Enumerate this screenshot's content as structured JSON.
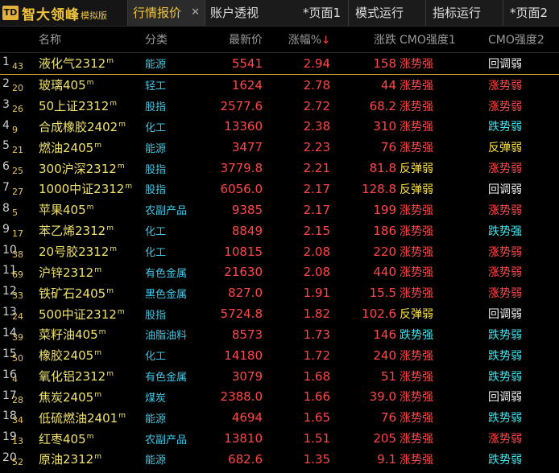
{
  "app": {
    "logo_mark": "TD",
    "title": "智大领峰",
    "subtitle": "模拟版"
  },
  "tabs": [
    {
      "label": "行情报价",
      "active": true,
      "closable": true
    },
    {
      "label": "账户透视"
    },
    {
      "label": "*页面1"
    },
    {
      "label": "模式运行"
    },
    {
      "label": "指标运行"
    },
    {
      "label": "*页面2"
    }
  ],
  "columns": {
    "name": "名称",
    "category": "分类",
    "price": "最新价",
    "pct": "涨幅%",
    "change": "涨跌",
    "cmo1": "CMO强度1",
    "cmo2": "CMO强度2"
  },
  "rows": [
    {
      "idx": "1",
      "sub": "43",
      "name": "液化气2312",
      "cat": "能源",
      "price": "5541",
      "pct": "2.94",
      "chg": "158",
      "cmo1": "涨势强",
      "cmo2": "回调弱"
    },
    {
      "idx": "2",
      "sub": "20",
      "name": "玻璃405",
      "cat": "轻工",
      "price": "1624",
      "pct": "2.78",
      "chg": "44",
      "cmo1": "涨势强",
      "cmo2": "涨势弱"
    },
    {
      "idx": "3",
      "sub": "26",
      "name": "50上证2312",
      "cat": "股指",
      "price": "2577.6",
      "pct": "2.72",
      "chg": "68.2",
      "cmo1": "涨势强",
      "cmo2": "涨势弱"
    },
    {
      "idx": "4",
      "sub": "9",
      "name": "合成橡胶2402",
      "cat": "化工",
      "price": "13360",
      "pct": "2.38",
      "chg": "310",
      "cmo1": "涨势强",
      "cmo2": "跌势弱"
    },
    {
      "idx": "5",
      "sub": "21",
      "name": "燃油2405",
      "cat": "能源",
      "price": "3477",
      "pct": "2.23",
      "chg": "76",
      "cmo1": "涨势强",
      "cmo2": "反弹弱"
    },
    {
      "idx": "6",
      "sub": "25",
      "name": "300沪深2312",
      "cat": "股指",
      "price": "3779.8",
      "pct": "2.21",
      "chg": "81.8",
      "cmo1": "反弹弱",
      "cmo2": "涨势弱"
    },
    {
      "idx": "7",
      "sub": "27",
      "name": "1000中证2312",
      "cat": "股指",
      "price": "6056.0",
      "pct": "2.17",
      "chg": "128.8",
      "cmo1": "反弹弱",
      "cmo2": "回调弱"
    },
    {
      "idx": "8",
      "sub": "5",
      "name": "苹果405",
      "cat": "农副产品",
      "price": "9385",
      "pct": "2.17",
      "chg": "199",
      "cmo1": "涨势强",
      "cmo2": "涨势弱"
    },
    {
      "idx": "9",
      "sub": "17",
      "name": "苯乙烯2312",
      "cat": "化工",
      "price": "8849",
      "pct": "2.15",
      "chg": "186",
      "cmo1": "涨势强",
      "cmo2": "跌势强"
    },
    {
      "idx": "10",
      "sub": "38",
      "name": "20号胶2312",
      "cat": "化工",
      "price": "10815",
      "pct": "2.08",
      "chg": "220",
      "cmo1": "涨势强",
      "cmo2": "涨势弱"
    },
    {
      "idx": "11",
      "sub": "69",
      "name": "沪锌2312",
      "cat": "有色金属",
      "price": "21630",
      "pct": "2.08",
      "chg": "440",
      "cmo1": "涨势强",
      "cmo2": "涨势弱"
    },
    {
      "idx": "12",
      "sub": "33",
      "name": "铁矿石2405",
      "cat": "黑色金属",
      "price": "827.0",
      "pct": "1.91",
      "chg": "15.5",
      "cmo1": "涨势强",
      "cmo2": "涨势弱"
    },
    {
      "idx": "13",
      "sub": "24",
      "name": "500中证2312",
      "cat": "股指",
      "price": "5724.8",
      "pct": "1.82",
      "chg": "102.6",
      "cmo1": "反弹弱",
      "cmo2": "回调弱"
    },
    {
      "idx": "14",
      "sub": "39",
      "name": "菜籽油405",
      "cat": "油脂油料",
      "price": "8573",
      "pct": "1.73",
      "chg": "146",
      "cmo1": "跌势强",
      "cmo2": "跌势弱"
    },
    {
      "idx": "15",
      "sub": "50",
      "name": "橡胶2405",
      "cat": "化工",
      "price": "14180",
      "pct": "1.72",
      "chg": "240",
      "cmo1": "涨势强",
      "cmo2": "跌势弱"
    },
    {
      "idx": "16",
      "sub": "4",
      "name": "氧化铝2312",
      "cat": "有色金属",
      "price": "3079",
      "pct": "1.68",
      "chg": "51",
      "cmo1": "涨势强",
      "cmo2": "跌势弱"
    },
    {
      "idx": "17",
      "sub": "28",
      "name": "焦炭2405",
      "cat": "煤炭",
      "price": "2388.0",
      "pct": "1.66",
      "chg": "39.0",
      "cmo1": "涨势强",
      "cmo2": "回调弱"
    },
    {
      "idx": "18",
      "sub": "34",
      "name": "低硫燃油2401",
      "cat": "能源",
      "price": "4694",
      "pct": "1.65",
      "chg": "76",
      "cmo1": "涨势强",
      "cmo2": "跌势弱"
    },
    {
      "idx": "19",
      "sub": "13",
      "name": "红枣405",
      "cat": "农副产品",
      "price": "13810",
      "pct": "1.51",
      "chg": "205",
      "cmo1": "涨势强",
      "cmo2": "涨势弱"
    },
    {
      "idx": "20",
      "sub": "52",
      "name": "原油2312",
      "cat": "能源",
      "price": "682.6",
      "pct": "1.35",
      "chg": "9.1",
      "cmo1": "涨势强",
      "cmo2": "跌势弱"
    }
  ]
}
